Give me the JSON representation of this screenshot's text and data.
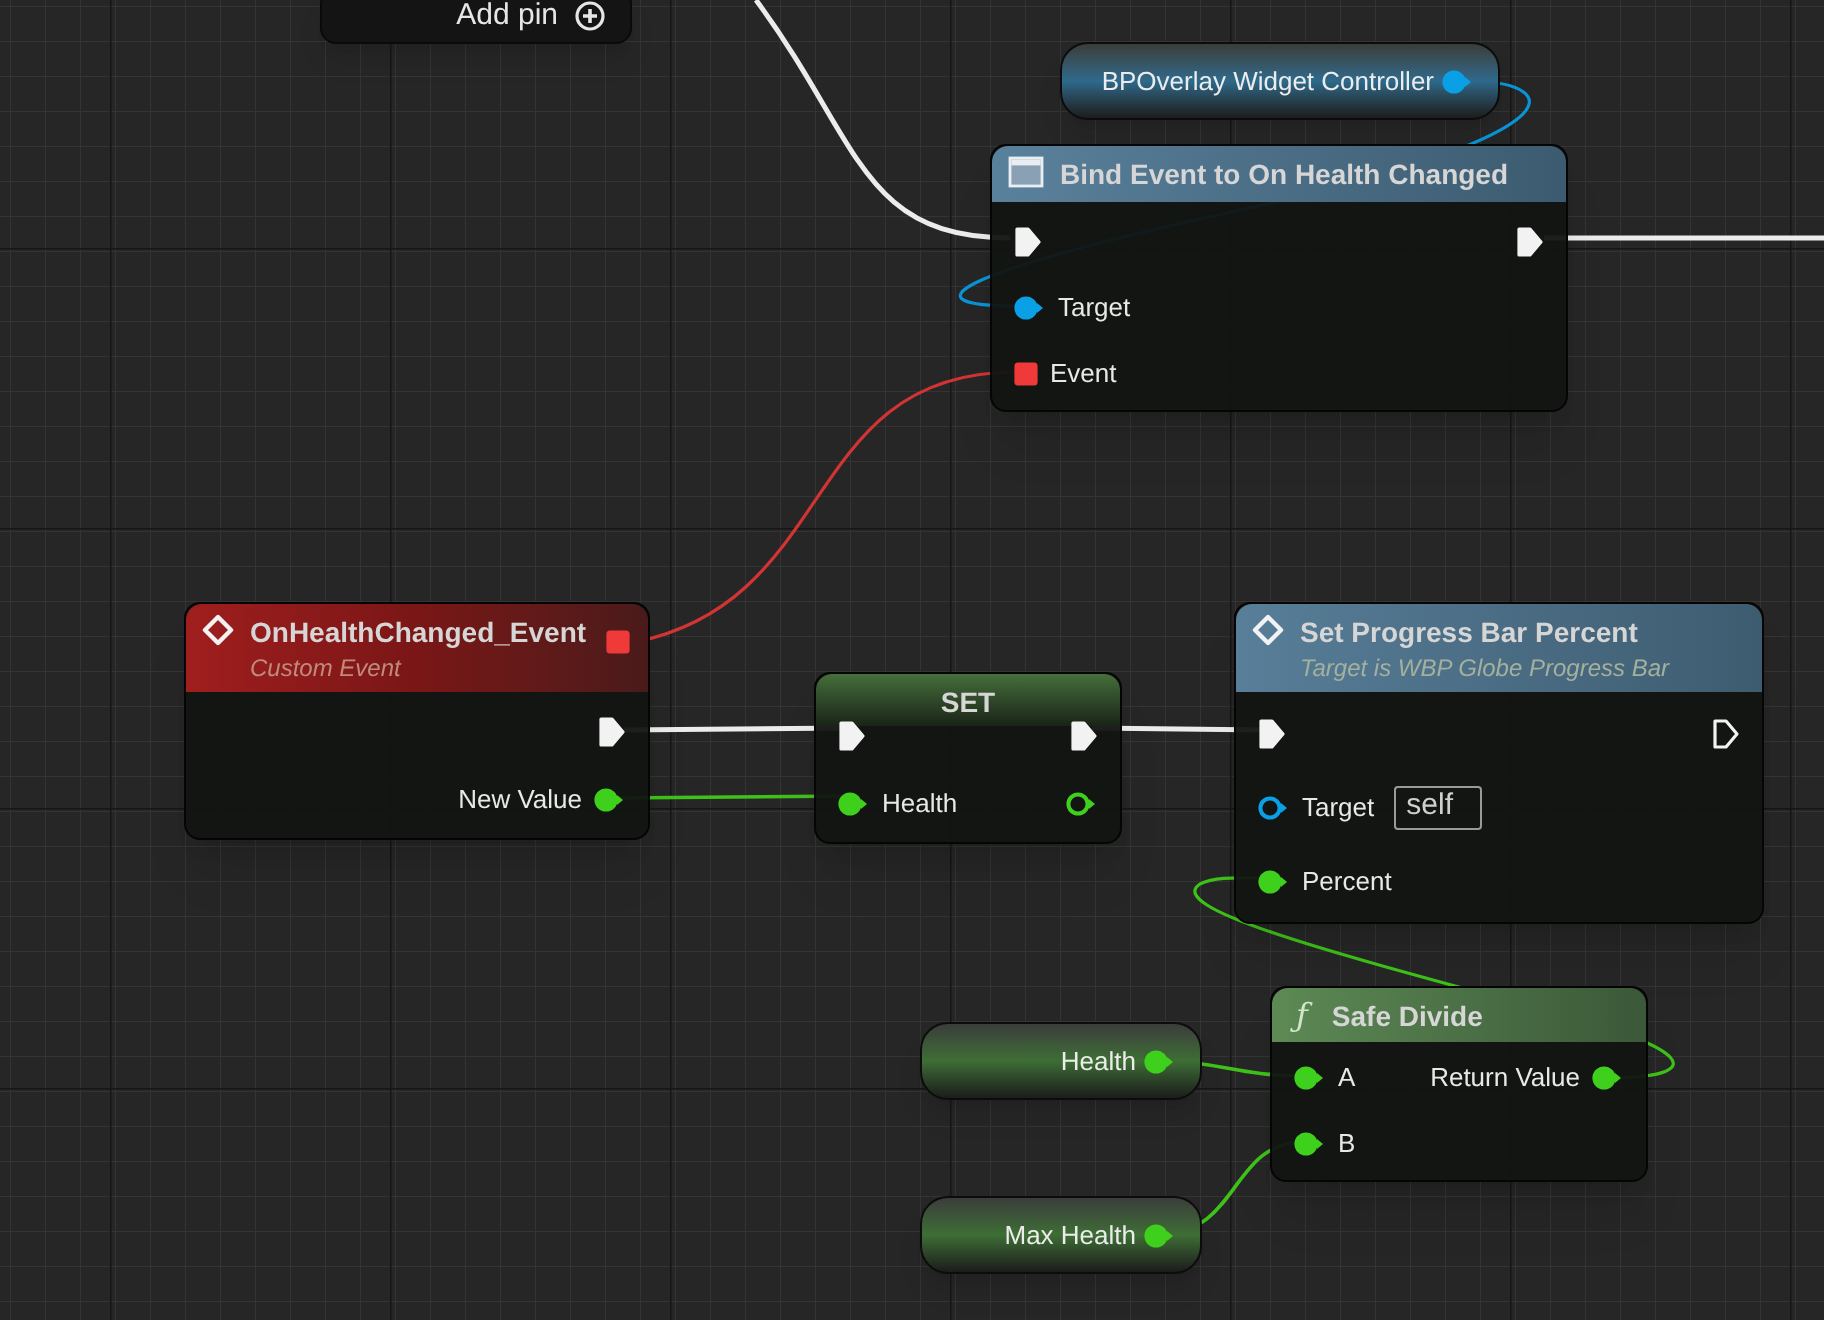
{
  "nodes": [
    {
      "kind": "stub",
      "button_label": "Add pin"
    },
    {
      "kind": "getter",
      "label": "BPOverlay Widget Controller",
      "outputs": [
        {
          "kind": "object",
          "connected": true
        }
      ]
    },
    {
      "kind": "delegate_bind",
      "title": "Bind Event to On Health Changed",
      "inputs": [
        {
          "kind": "exec",
          "connected": true
        },
        {
          "kind": "object",
          "label": "Target",
          "connected": true
        },
        {
          "kind": "delegate",
          "label": "Event",
          "connected": true
        }
      ],
      "outputs": [
        {
          "kind": "exec",
          "connected": true
        }
      ]
    },
    {
      "kind": "event",
      "title": "OnHealthChanged_Event",
      "subtitle": "Custom Event",
      "header_pin": {
        "kind": "delegate",
        "connected": true
      },
      "outputs": [
        {
          "kind": "exec",
          "connected": true
        },
        {
          "kind": "float",
          "label": "New Value",
          "connected": true
        }
      ]
    },
    {
      "kind": "set",
      "title": "SET",
      "inputs": [
        {
          "kind": "exec",
          "connected": true
        },
        {
          "kind": "float",
          "label": "Health",
          "connected": true
        }
      ],
      "outputs": [
        {
          "kind": "exec",
          "connected": true
        },
        {
          "kind": "float",
          "connected": false
        }
      ]
    },
    {
      "kind": "function",
      "title": "Set Progress Bar Percent",
      "subtitle": "Target is WBP Globe Progress Bar",
      "inputs": [
        {
          "kind": "exec",
          "connected": true
        },
        {
          "kind": "object",
          "label": "Target",
          "connected": false,
          "default_value": "self"
        },
        {
          "kind": "float",
          "label": "Percent",
          "connected": true
        }
      ],
      "outputs": [
        {
          "kind": "exec",
          "connected": false
        }
      ]
    },
    {
      "kind": "pure",
      "glyph": "ƒ",
      "title": "Safe Divide",
      "inputs": [
        {
          "kind": "float",
          "label": "A",
          "connected": true
        },
        {
          "kind": "float",
          "label": "B",
          "connected": true
        }
      ],
      "outputs": [
        {
          "kind": "float",
          "label": "Return Value",
          "connected": true
        }
      ]
    },
    {
      "kind": "getter",
      "label": "Health",
      "outputs": [
        {
          "kind": "float",
          "connected": true
        }
      ]
    },
    {
      "kind": "getter",
      "label": "Max Health",
      "outputs": [
        {
          "kind": "float",
          "connected": true
        }
      ]
    }
  ]
}
